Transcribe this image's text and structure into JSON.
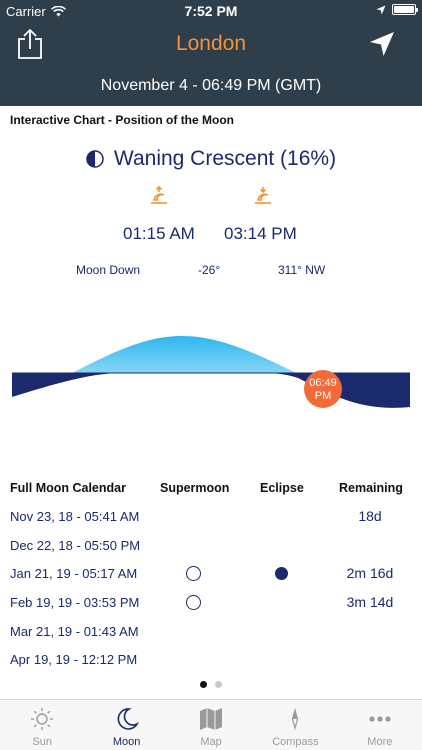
{
  "status": {
    "carrier": "Carrier",
    "time": "7:52 PM"
  },
  "header": {
    "title": "London",
    "date_line": "November 4 - 06:49 PM (GMT)"
  },
  "chart_section": {
    "heading": "Interactive Chart - Position of the Moon"
  },
  "moon": {
    "phase": "Waning Crescent (16%)",
    "moonrise_time": "01:15 AM",
    "moonset_time": "03:14 PM",
    "status": "Moon Down",
    "altitude": "-26°",
    "azimuth": "311° NW",
    "marker_time": "06:49",
    "marker_ampm": "PM"
  },
  "calendar": {
    "headers": {
      "date": "Full Moon Calendar",
      "supermoon": "Supermoon",
      "eclipse": "Eclipse",
      "remaining": "Remaining"
    },
    "rows": [
      {
        "date": "Nov 23, 18 - 05:41 AM",
        "remaining": "18d",
        "supermoon": false,
        "eclipse": false
      },
      {
        "date": "Dec 22, 18 - 05:50 PM",
        "remaining": "",
        "supermoon": false,
        "eclipse": false
      },
      {
        "date": "Jan 21, 19 - 05:17 AM",
        "remaining": "2m 16d",
        "supermoon": true,
        "eclipse": true
      },
      {
        "date": "Feb 19, 19 - 03:53 PM",
        "remaining": "3m 14d",
        "supermoon": true,
        "eclipse": false
      },
      {
        "date": "Mar 21, 19 - 01:43 AM",
        "remaining": "",
        "supermoon": false,
        "eclipse": false
      },
      {
        "date": "Apr 19, 19 - 12:12 PM",
        "remaining": "",
        "supermoon": false,
        "eclipse": false
      }
    ]
  },
  "pager": {
    "pages": 2,
    "active": 0
  },
  "tabs": [
    {
      "label": "Sun",
      "icon": "sun-icon"
    },
    {
      "label": "Moon",
      "icon": "moon-icon",
      "active": true
    },
    {
      "label": "Map",
      "icon": "map-icon"
    },
    {
      "label": "Compass",
      "icon": "compass-icon"
    },
    {
      "label": "More",
      "icon": "more-icon"
    }
  ],
  "colors": {
    "header_bg": "#2e3e4b",
    "accent_orange": "#f4923a",
    "navy": "#1a2a6c",
    "sky_blue": "#4fc3f0",
    "marker": "#f26a3a"
  }
}
